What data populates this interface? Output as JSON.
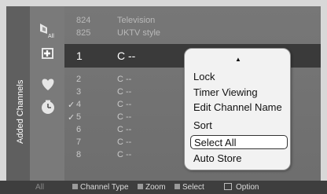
{
  "side_tab": {
    "label": "Added Channels"
  },
  "categories": [
    {
      "name": "all-channels-icon",
      "badge": "All"
    },
    {
      "name": "added-channels-icon",
      "badge": ""
    },
    {
      "name": "favorite-icon",
      "badge": ""
    },
    {
      "name": "timer-clock-icon",
      "badge": ""
    }
  ],
  "channels": [
    {
      "check": "",
      "number": "824",
      "name": "Television"
    },
    {
      "check": "",
      "number": "825",
      "name": "UKTV style"
    },
    {
      "check": "",
      "number": "1",
      "name": "C --"
    },
    {
      "check": "",
      "number": "2",
      "name": "C --"
    },
    {
      "check": "",
      "number": "3",
      "name": "C --"
    },
    {
      "check": "✓",
      "number": "4",
      "name": "C --"
    },
    {
      "check": "✓",
      "number": "5",
      "name": "C --"
    },
    {
      "check": "",
      "number": "6",
      "name": "C --"
    },
    {
      "check": "",
      "number": "7",
      "name": "C --"
    },
    {
      "check": "",
      "number": "8",
      "name": "C --"
    }
  ],
  "popup": {
    "scroll_up": "▲",
    "items": [
      "Lock",
      "Timer Viewing",
      "Edit Channel Name",
      "Sort",
      "Select All",
      "Auto Store"
    ],
    "active_index": 4
  },
  "footer": {
    "all_label": "All",
    "channel_type": "Channel Type",
    "zoom": "Zoom",
    "select": "Select",
    "option": "Option"
  }
}
